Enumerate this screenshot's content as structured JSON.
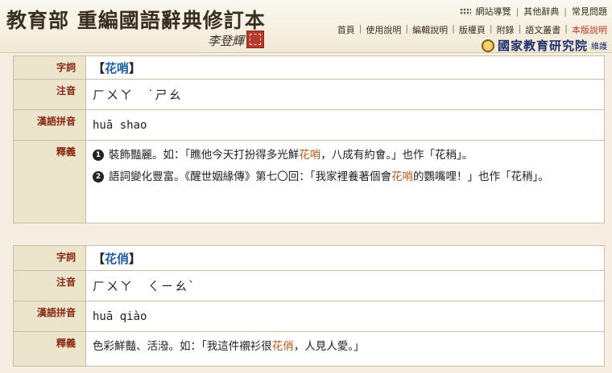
{
  "header": {
    "title": "教育部 重編國語辭典修訂本",
    "signature": "李登輝 署",
    "top_links": [
      "網站導覽",
      "其他辭典",
      "常見問題"
    ],
    "nav": [
      "首頁",
      "使用說明",
      "編輯說明",
      "版權頁",
      "附錄",
      "語文叢書",
      "本版說明"
    ],
    "nav_active_index": 6,
    "org_name": "國家教育研究院",
    "org_sub": "維護"
  },
  "labels": {
    "word": "字詞",
    "bopomofo": "注音",
    "pinyin": "漢語拼音",
    "definition": "釋義"
  },
  "entries": [
    {
      "word": "花哨",
      "bopomofo": "ㄏㄨㄚ　˙ㄕㄠ",
      "pinyin": "huā shao",
      "definitions": [
        {
          "number": "1",
          "before": "裝飾豔麗。如：「瞧他今天打扮得多光鮮",
          "highlight": "花哨",
          "after": "，八成有約會。」也作「花稍」。"
        },
        {
          "number": "2",
          "before": "語詞變化豐富。《醒世姻緣傳》第七〇回：「我家裡養著個會",
          "highlight": "花哨",
          "after": "的鸚嘴哩！」也作「花稍」。"
        }
      ]
    },
    {
      "word": "花俏",
      "bopomofo": "ㄏㄨㄚ　ㄑㄧㄠˋ",
      "pinyin": "huā qiào",
      "definitions": [
        {
          "number": "",
          "before": "色彩鮮豔、活潑。如：「我這件襯衫很",
          "highlight": "花俏",
          "after": "，人見人愛。」"
        }
      ]
    }
  ],
  "colors": {
    "background": "#f4efe2",
    "label_bg": "#ece5cc",
    "label_text": "#8a2a14",
    "word_text": "#1f5ea8",
    "highlight": "#b55a17",
    "active_nav": "#c0392b"
  }
}
